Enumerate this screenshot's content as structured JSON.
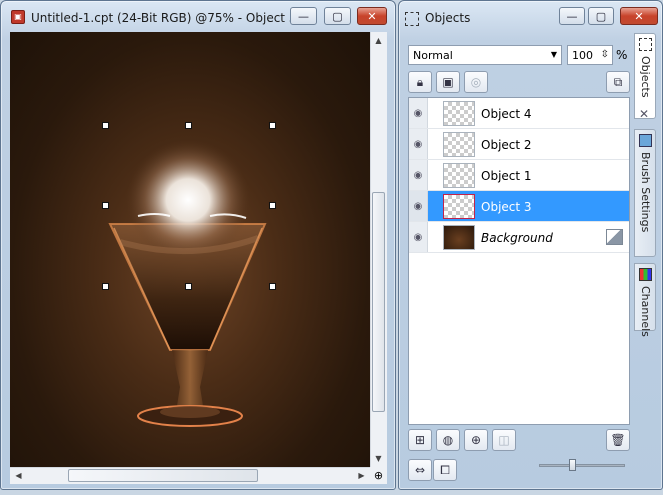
{
  "document_window": {
    "title": "Untitled-1.cpt (24-Bit RGB) @75% - Object 3",
    "minimize": "—",
    "maximize": "▢",
    "close": "✕"
  },
  "objects_window": {
    "title": "Objects",
    "minimize": "—",
    "maximize": "▢",
    "close": "✕"
  },
  "objects_panel": {
    "blend_mode": "Normal",
    "opacity": "100",
    "opacity_unit": "%",
    "layers": [
      {
        "name": "Object 4",
        "selected": false,
        "italic": false
      },
      {
        "name": "Object 2",
        "selected": false,
        "italic": false
      },
      {
        "name": "Object 1",
        "selected": false,
        "italic": false
      },
      {
        "name": "Object 3",
        "selected": true,
        "italic": false
      },
      {
        "name": "Background",
        "selected": false,
        "italic": true
      }
    ]
  },
  "side_tabs": {
    "objects": "Objects",
    "brush_settings": "Brush Settings",
    "channels": "Channels",
    "close": "✕"
  },
  "colors": {
    "selection": "#3399ff",
    "canvas_bg": "#2a190c",
    "glass_glow": "#e07a3a"
  }
}
